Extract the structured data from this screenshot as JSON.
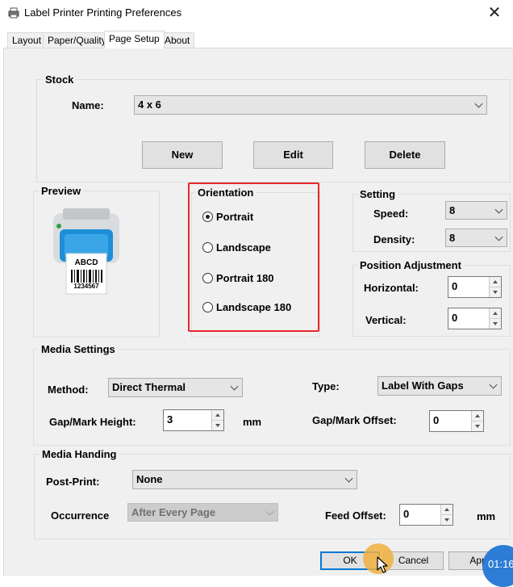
{
  "window": {
    "title": "Label Printer Printing Preferences",
    "close_symbol": "✕",
    "icon": "printer-icon"
  },
  "tabs": [
    {
      "label": "Layout",
      "active": false
    },
    {
      "label": "Paper/Quality",
      "active": false
    },
    {
      "label": "Page Setup",
      "active": true
    },
    {
      "label": "About",
      "active": false
    }
  ],
  "stock": {
    "title": "Stock",
    "name_label": "Name:",
    "name_value": "4 x 6",
    "new_label": "New",
    "edit_label": "Edit",
    "delete_label": "Delete"
  },
  "preview": {
    "title": "Preview",
    "label_text": "ABCD",
    "label_number": "1234567",
    "image": "label-printer-icon"
  },
  "orientation": {
    "title": "Orientation",
    "options": [
      {
        "label": "Portrait",
        "checked": true
      },
      {
        "label": "Landscape",
        "checked": false
      },
      {
        "label": "Portrait 180",
        "checked": false
      },
      {
        "label": "Landscape 180",
        "checked": false
      }
    ],
    "highlight_color": "#e8262a"
  },
  "setting": {
    "title": "Setting",
    "speed_label": "Speed:",
    "speed_value": "8",
    "density_label": "Density:",
    "density_value": "8"
  },
  "position_adjustment": {
    "title": "Position Adjustment",
    "horizontal_label": "Horizontal:",
    "horizontal_value": "0",
    "vertical_label": "Vertical:",
    "vertical_value": "0"
  },
  "media_settings": {
    "title": "Media Settings",
    "method_label": "Method:",
    "method_value": "Direct Thermal",
    "type_label": "Type:",
    "type_value": "Label With Gaps",
    "gap_height_label": "Gap/Mark Height:",
    "gap_height_value": "3",
    "gap_height_unit": "mm",
    "gap_offset_label": "Gap/Mark Offset:",
    "gap_offset_value": "0"
  },
  "media_handing": {
    "title": "Media Handing",
    "post_print_label": "Post-Print:",
    "post_print_value": "None",
    "occurrence_label": "Occurrence",
    "occurrence_value": "After Every Page",
    "feed_offset_label": "Feed Offset:",
    "feed_offset_value": "0",
    "feed_offset_unit": "mm"
  },
  "footer": {
    "ok_label": "OK",
    "cancel_label": "Cancel",
    "apply_label": "App",
    "overlay_text": "01:16"
  },
  "colors": {
    "panel_bg": "#f0f0f0",
    "accent": "#0078d7",
    "cursor_highlight": "#f0b040",
    "overlay_badge": "#2d7cd6"
  }
}
